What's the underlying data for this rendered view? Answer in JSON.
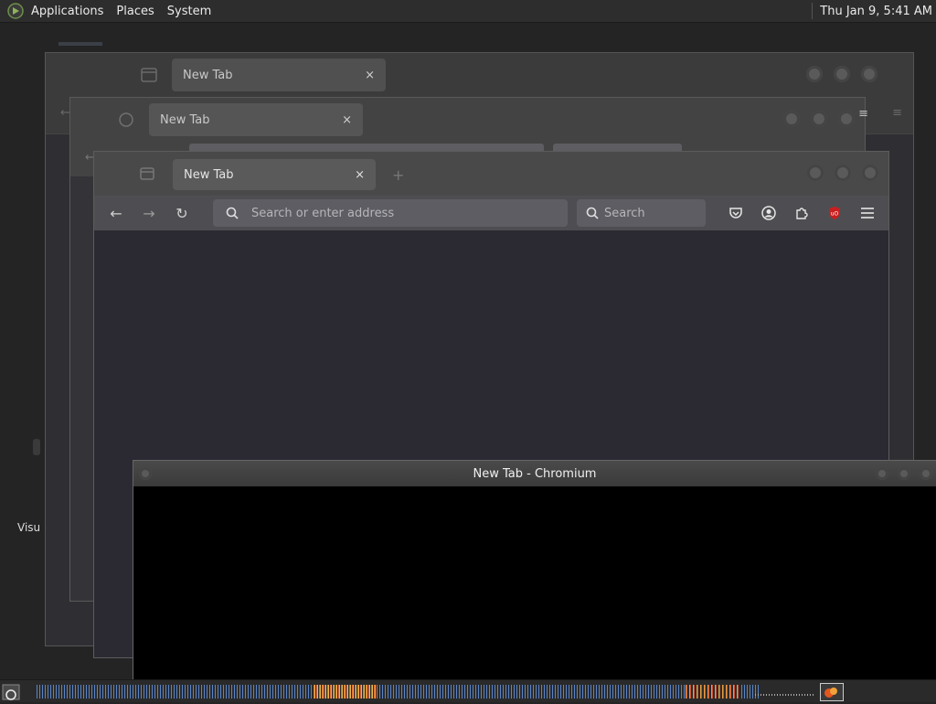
{
  "top_panel": {
    "menus": [
      "Applications",
      "Places",
      "System"
    ],
    "clock": "Thu Jan  9,  5:41 AM"
  },
  "desktop": {
    "label": "Visu"
  },
  "back_window_a": {
    "tab_title": "New Tab",
    "tab_close": "×"
  },
  "back_window_b": {
    "tab_title": "New Tab",
    "tab_close": "×"
  },
  "firefox": {
    "tab_title": "New Tab",
    "tab_close": "×",
    "url_placeholder": "Search or enter address",
    "search_placeholder": "Search",
    "nav": {
      "back": "←",
      "forward": "→",
      "reload": "↻"
    }
  },
  "chromium": {
    "title": "New Tab - Chromium"
  },
  "colors": {
    "panel": "#2d2d2d",
    "firefox_bg": "#2b2a33",
    "ublock": "#c91f1f",
    "chromium_content": "#000000"
  }
}
